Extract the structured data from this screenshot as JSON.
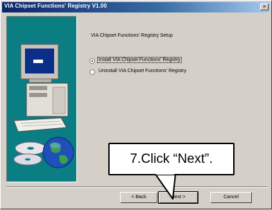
{
  "window": {
    "title": "VIA Chipset Functions' Registry V1.00",
    "close_glyph": "×"
  },
  "content": {
    "heading": "VIA Chipset Functions' Registry Setup",
    "options": [
      {
        "label": "Install VIA Chipset Functions' Registry",
        "selected": true
      },
      {
        "label": "Uninstall VIA Chipset Functions' Registry",
        "selected": false
      }
    ]
  },
  "buttons": {
    "back": "< Back",
    "next": "Next >",
    "cancel": "Cancel"
  },
  "callout": {
    "text": "7.Click “Next”."
  },
  "colors": {
    "titlebar_start": "#0a246a",
    "panel_teal": "#0a7e83",
    "dialog_face": "#d4d0c8"
  }
}
